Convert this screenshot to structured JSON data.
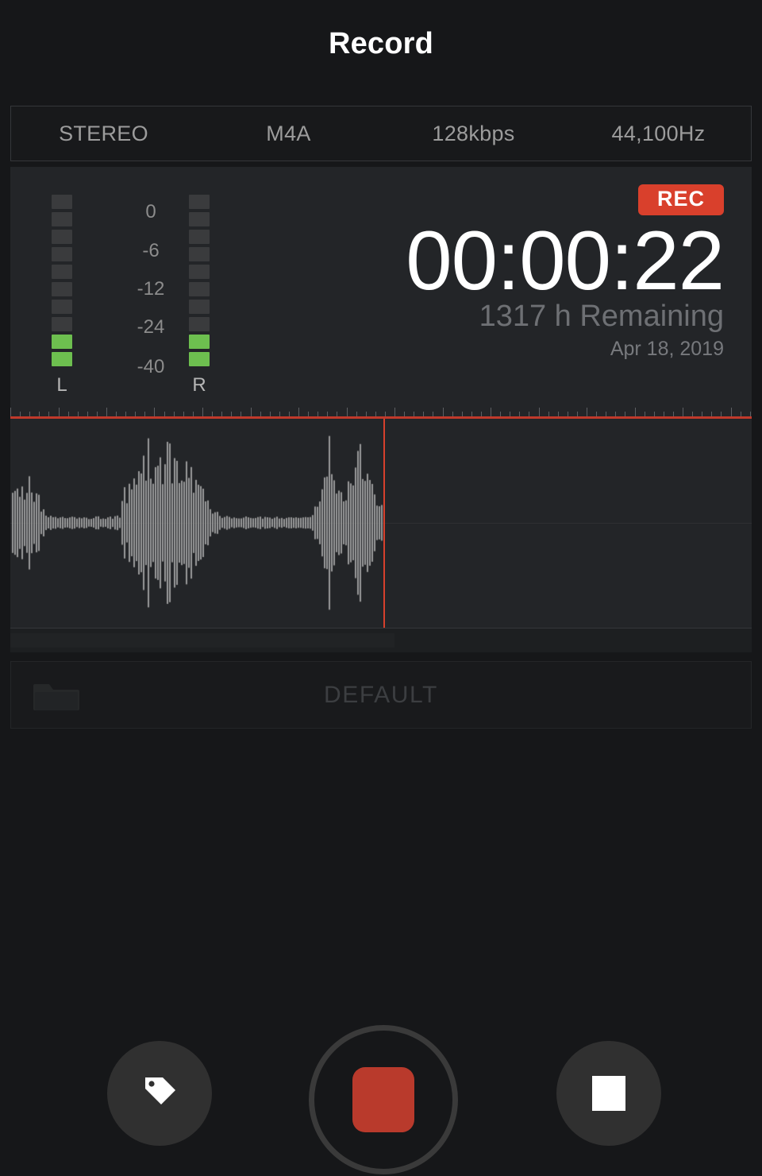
{
  "header": {
    "title": "Record"
  },
  "settings_bar": {
    "items": [
      {
        "label": "STEREO",
        "name": "channel-mode"
      },
      {
        "label": "M4A",
        "name": "file-format"
      },
      {
        "label": "128kbps",
        "name": "bitrate"
      },
      {
        "label": "44,100Hz",
        "name": "sample-rate"
      }
    ]
  },
  "meters": {
    "left": {
      "label": "L",
      "segments_total": 10,
      "segments_lit": 2
    },
    "right": {
      "label": "R",
      "segments_total": 10,
      "segments_lit": 2
    },
    "scale_labels": [
      "0",
      "-6",
      "-12",
      "-24",
      "-40"
    ],
    "colors": {
      "segment_off": "#3a3b3d",
      "segment_on": "#6dbf4f"
    }
  },
  "timer": {
    "status_badge": "REC",
    "elapsed": "00:00:22",
    "remaining": "1317 h Remaining",
    "date": "Apr 18, 2019",
    "badge_color": "#d9402c"
  },
  "waveform": {
    "playhead_x_pct": 50.3,
    "wave_color": "#9a9a9a",
    "playhead_color": "#d6402c",
    "ruler_line_color": "#c0392b"
  },
  "folder": {
    "icon": "folder-icon",
    "name": "DEFAULT"
  },
  "transport": {
    "tag_button": {
      "icon": "tag-icon",
      "label": "Tag"
    },
    "record_button": {
      "icon": "record-square-icon",
      "label": "Record",
      "color": "#b93a2c"
    },
    "stop_button": {
      "icon": "stop-square-icon",
      "label": "Stop"
    }
  }
}
